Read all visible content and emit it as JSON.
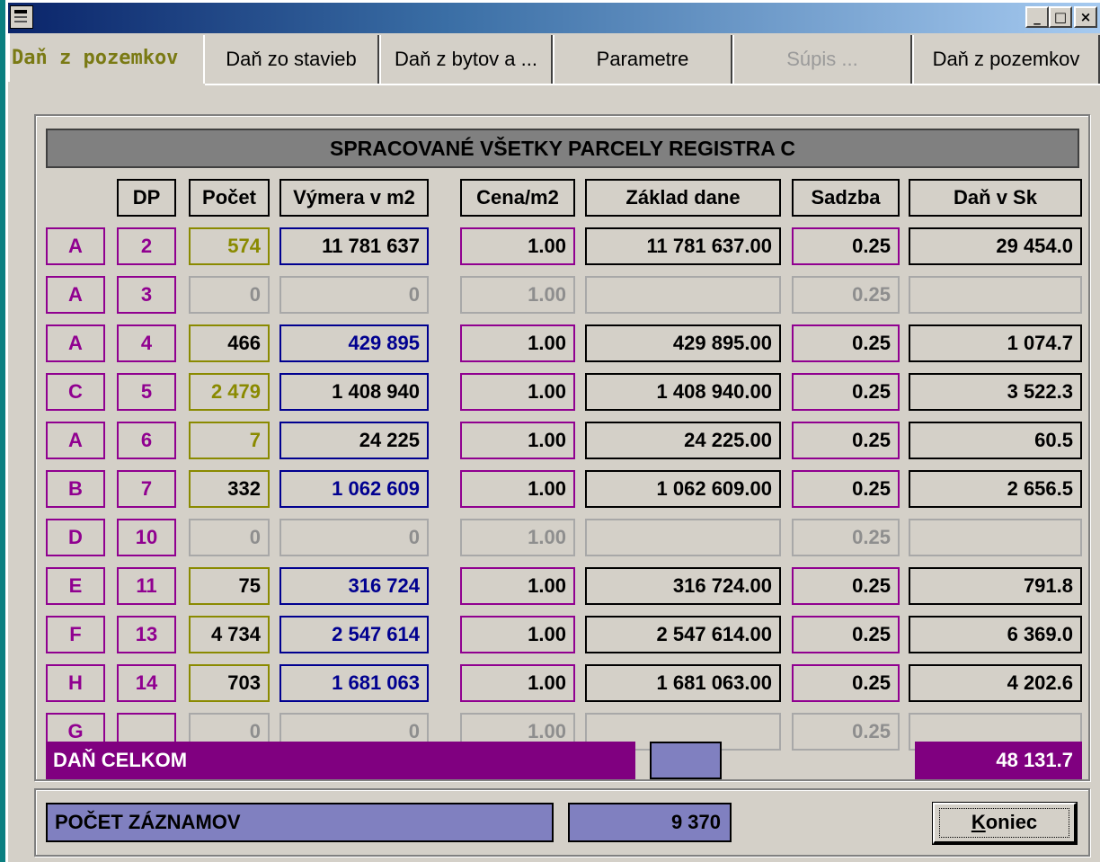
{
  "window": {
    "icon": "form-icon",
    "controls": {
      "minimize": "_",
      "maximize": "□",
      "close": "×"
    }
  },
  "tabs": [
    {
      "label": "Daň z pozemkov",
      "state": "active"
    },
    {
      "label": "Daň zo stavieb",
      "state": "normal"
    },
    {
      "label": "Daň z bytov a ...",
      "state": "normal"
    },
    {
      "label": "Parametre",
      "state": "normal"
    },
    {
      "label": "Súpis ...",
      "state": "disabled"
    },
    {
      "label": "Daň z pozemkov",
      "state": "normal"
    }
  ],
  "panel": {
    "banner": "SPRACOVANÉ VŠETKY PARCELY REGISTRA C",
    "headers": {
      "dp": "DP",
      "pocet": "Počet",
      "vymera": "Výmera v m2",
      "cena": "Cena/m2",
      "zaklad": "Základ dane",
      "sadzba": "Sadzba",
      "dan": "Daň v Sk"
    },
    "rows": [
      {
        "druh": "A",
        "dp": "2",
        "pocet": "574",
        "vymera": "11 781 637",
        "cena": "1.00",
        "zaklad": "11 781 637.00",
        "sadzba": "0.25",
        "dan": "29 454.0"
      },
      {
        "druh": "A",
        "dp": "3",
        "pocet": "0",
        "vymera": "0",
        "cena": "1.00",
        "zaklad": "",
        "sadzba": "0.25",
        "dan": ""
      },
      {
        "druh": "A",
        "dp": "4",
        "pocet": "466",
        "vymera": "429 895",
        "cena": "1.00",
        "zaklad": "429 895.00",
        "sadzba": "0.25",
        "dan": "1 074.7"
      },
      {
        "druh": "C",
        "dp": "5",
        "pocet": "2 479",
        "vymera": "1 408 940",
        "cena": "1.00",
        "zaklad": "1 408 940.00",
        "sadzba": "0.25",
        "dan": "3 522.3"
      },
      {
        "druh": "A",
        "dp": "6",
        "pocet": "7",
        "vymera": "24 225",
        "cena": "1.00",
        "zaklad": "24 225.00",
        "sadzba": "0.25",
        "dan": "60.5"
      },
      {
        "druh": "B",
        "dp": "7",
        "pocet": "332",
        "vymera": "1 062 609",
        "cena": "1.00",
        "zaklad": "1 062 609.00",
        "sadzba": "0.25",
        "dan": "2 656.5"
      },
      {
        "druh": "D",
        "dp": "10",
        "pocet": "0",
        "vymera": "0",
        "cena": "1.00",
        "zaklad": "",
        "sadzba": "0.25",
        "dan": ""
      },
      {
        "druh": "E",
        "dp": "11",
        "pocet": "75",
        "vymera": "316 724",
        "cena": "1.00",
        "zaklad": "316 724.00",
        "sadzba": "0.25",
        "dan": "791.8"
      },
      {
        "druh": "F",
        "dp": "13",
        "pocet": "4 734",
        "vymera": "2 547 614",
        "cena": "1.00",
        "zaklad": "2 547 614.00",
        "sadzba": "0.25",
        "dan": "6 369.0"
      },
      {
        "druh": "H",
        "dp": "14",
        "pocet": "703",
        "vymera": "1 681 063",
        "cena": "1.00",
        "zaklad": "1 681 063.00",
        "sadzba": "0.25",
        "dan": "4 202.6"
      },
      {
        "druh": "G",
        "dp": "",
        "pocet": "0",
        "vymera": "0",
        "cena": "1.00",
        "zaklad": "",
        "sadzba": "0.25",
        "dan": ""
      }
    ],
    "total_label": "DAŇ CELKOM",
    "total_value": "48 131.7"
  },
  "footer": {
    "count_label": "POČET ZÁZNAMOV",
    "count_value": "9 370",
    "close_button": "Koniec"
  },
  "colors": {
    "purple": "#800080",
    "lavender": "#8080c0",
    "olive": "#8a8a00",
    "navy": "#000090",
    "face": "#d4d0c8"
  }
}
